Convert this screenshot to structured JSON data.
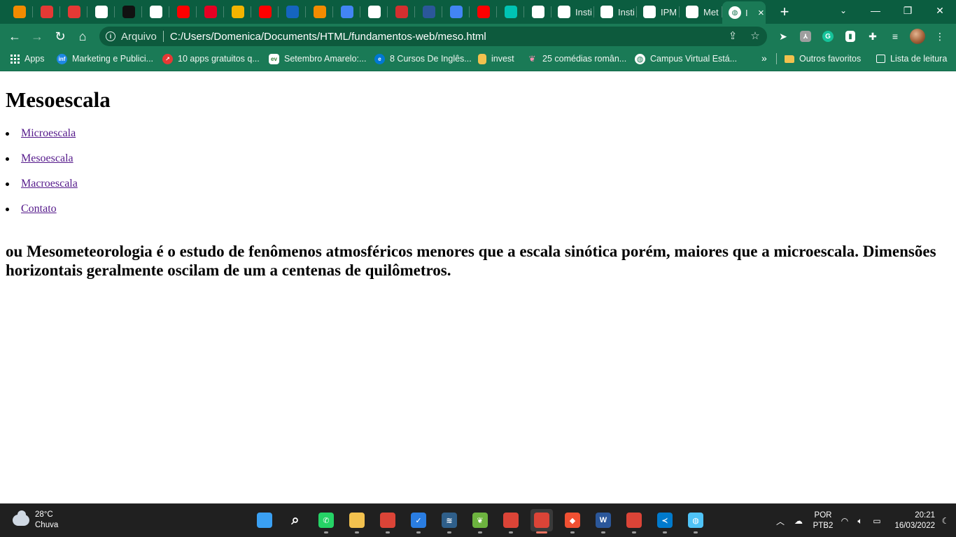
{
  "browser": {
    "tabs": [
      {
        "icon": "cloud-icon",
        "color": "#f28b00",
        "label": ""
      },
      {
        "icon": "trending-icon",
        "color": "#e53935",
        "label": ""
      },
      {
        "icon": "loading-ring-icon",
        "color": "#e53935",
        "label": ""
      },
      {
        "icon": "github-icon",
        "color": "#ffffff",
        "label": ""
      },
      {
        "icon": "a-letter-icon",
        "color": "#111111",
        "label": ""
      },
      {
        "icon": "globe-icon",
        "color": "#ffffff",
        "label": ""
      },
      {
        "icon": "youtube-icon",
        "color": "#ff0000",
        "label": ""
      },
      {
        "icon": "pinterest-icon",
        "color": "#e60023",
        "label": ""
      },
      {
        "icon": "slides-icon",
        "color": "#f4b400",
        "label": ""
      },
      {
        "icon": "youtube-icon",
        "color": "#ff0000",
        "label": ""
      },
      {
        "icon": "d-logo-icon",
        "color": "#1565c0",
        "label": ""
      },
      {
        "icon": "c-logo-icon",
        "color": "#f28b00",
        "label": ""
      },
      {
        "icon": "triangle-a-icon",
        "color": "#4285f4",
        "label": ""
      },
      {
        "icon": "google-icon",
        "color": "#ffffff",
        "label": ""
      },
      {
        "icon": "pdf-icon",
        "color": "#d32f2f",
        "label": ""
      },
      {
        "icon": "word-icon",
        "color": "#2b579a",
        "label": ""
      },
      {
        "icon": "docs-icon",
        "color": "#4285f4",
        "label": ""
      },
      {
        "icon": "youtube-icon",
        "color": "#ff0000",
        "label": ""
      },
      {
        "icon": "e-logo-icon",
        "color": "#00c4b4",
        "label": ""
      },
      {
        "icon": "speaker-icon",
        "color": "#ffffff",
        "label": ""
      }
    ],
    "named_tabs": [
      {
        "icon": "gov-icon",
        "label": "Insti"
      },
      {
        "icon": "gov-icon",
        "label": "Insti"
      },
      {
        "icon": "ipm-icon",
        "label": "IPM"
      },
      {
        "icon": "globe-icon",
        "label": "Met"
      }
    ],
    "active_tab": {
      "label": "I",
      "close": "×"
    },
    "new_tab": "+",
    "window_controls": {
      "dropdown": "⌄",
      "minimize": "—",
      "restore": "❐",
      "close": "✕"
    },
    "address": {
      "security_label": "Arquivo",
      "url": "C:/Users/Domenica/Documents/HTML/fundamentos-web/meso.html"
    },
    "bookmarks": [
      {
        "label": "Apps",
        "icon": "apps-grid-icon",
        "color": "#ffffff"
      },
      {
        "label": "Marketing e Publici...",
        "icon": "inf-icon",
        "color": "#1e88e5"
      },
      {
        "label": "10 apps gratuitos q...",
        "icon": "trending-icon",
        "color": "#e53935"
      },
      {
        "label": "Setembro Amarelo:...",
        "icon": "ev-icon",
        "color": "#ffffff"
      },
      {
        "label": "8 Cursos De Inglês...",
        "icon": "edge-icon",
        "color": "#0078d4"
      },
      {
        "label": "invest",
        "icon": "note-icon",
        "color": "#f2c14e"
      },
      {
        "label": "25 comédias român...",
        "icon": "film-icon",
        "color": "#c2185b"
      },
      {
        "label": "Campus Virtual Está...",
        "icon": "globe-icon",
        "color": "#ffffff"
      }
    ],
    "bookmarks_more": "»",
    "other_favorites": "Outros favoritos",
    "reading_list": "Lista de leitura"
  },
  "page": {
    "title": "Mesoescala",
    "nav": [
      {
        "label": "Microescala"
      },
      {
        "label": "Mesoescala"
      },
      {
        "label": "Macroescala"
      },
      {
        "label": "Contato"
      }
    ],
    "description": "ou Mesometeorologia é o estudo de fenômenos atmosféricos menores que a escala sinótica porém, maiores que a microescala. Dimensões horizontais geralmente oscilam de um a centenas de quilômetros."
  },
  "taskbar": {
    "weather": {
      "temp": "28°C",
      "condition": "Chuva"
    },
    "apps": [
      {
        "icon": "windows-start-icon",
        "color": "#3aa0f3",
        "glyph": ""
      },
      {
        "icon": "search-icon",
        "color": "#202020",
        "glyph": "⌕"
      },
      {
        "icon": "whatsapp-icon",
        "color": "#25d366",
        "glyph": "✆"
      },
      {
        "icon": "file-explorer-icon",
        "color": "#f2c14e",
        "glyph": ""
      },
      {
        "icon": "chrome-icon",
        "color": "#db4437",
        "glyph": ""
      },
      {
        "icon": "todo-icon",
        "color": "#2a7de1",
        "glyph": "✓"
      },
      {
        "icon": "mysql-workbench-icon",
        "color": "#2f5f8a",
        "glyph": "≋"
      },
      {
        "icon": "spring-icon",
        "color": "#6db33f",
        "glyph": "❦"
      },
      {
        "icon": "chrome-profile-icon",
        "color": "#db4437",
        "glyph": ""
      },
      {
        "icon": "chrome-profile-icon",
        "color": "#db4437",
        "glyph": ""
      },
      {
        "icon": "git-icon",
        "color": "#f05032",
        "glyph": "◆"
      },
      {
        "icon": "word-icon",
        "color": "#2b579a",
        "glyph": "W"
      },
      {
        "icon": "chrome-profile-icon",
        "color": "#db4437",
        "glyph": ""
      },
      {
        "icon": "vscode-icon",
        "color": "#007acc",
        "glyph": "≺"
      },
      {
        "icon": "map-app-icon",
        "color": "#4fc3f7",
        "glyph": "◍"
      }
    ],
    "active_app_index": 9,
    "language": {
      "line1": "POR",
      "line2": "PTB2"
    },
    "clock": {
      "time": "20:21",
      "date": "16/03/2022"
    }
  }
}
